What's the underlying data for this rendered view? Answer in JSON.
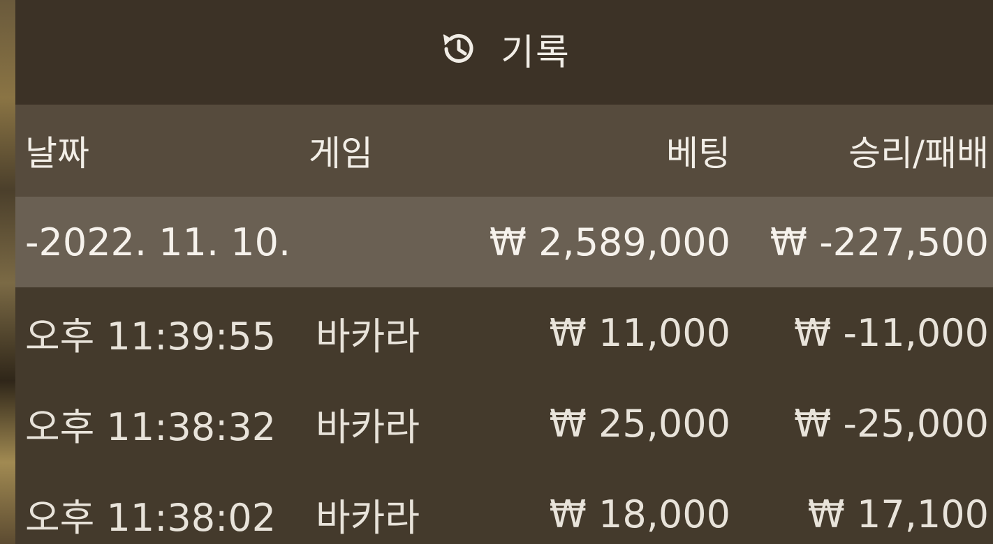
{
  "header": {
    "icon": "history-icon",
    "title": "기록"
  },
  "columns": {
    "date": "날짜",
    "game": "게임",
    "bet": "베팅",
    "result": "승리/패배"
  },
  "date_group": {
    "date": "-2022. 11. 10.",
    "bet_total": "₩ 2,589,000",
    "result_total": "₩ -227,500"
  },
  "rows": [
    {
      "time": "오후 11:39:55",
      "game": "바카라",
      "bet": "₩ 11,000",
      "result": "₩ -11,000"
    },
    {
      "time": "오후 11:38:32",
      "game": "바카라",
      "bet": "₩ 25,000",
      "result": "₩ -25,000"
    },
    {
      "time": "오후 11:38:02",
      "game": "바카라",
      "bet": "₩ 18,000",
      "result": "₩ 17,100"
    }
  ],
  "colors": {
    "header_bg": "#3c3226",
    "column_header_bg": "#564b3d",
    "date_row_bg": "#6a6053",
    "panel_bg": "#443a2c",
    "text": "#f1ede6"
  }
}
